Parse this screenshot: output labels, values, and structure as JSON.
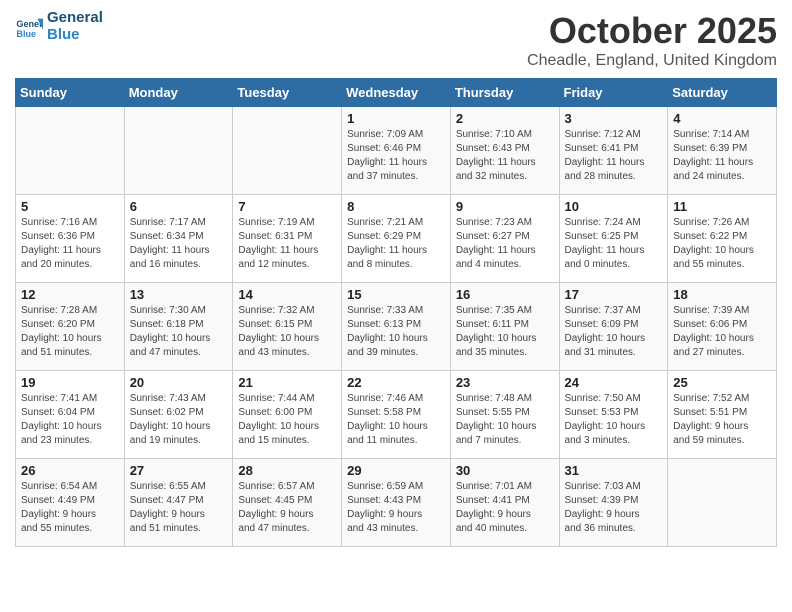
{
  "logo": {
    "line1": "General",
    "line2": "Blue"
  },
  "title": "October 2025",
  "location": "Cheadle, England, United Kingdom",
  "days_of_week": [
    "Sunday",
    "Monday",
    "Tuesday",
    "Wednesday",
    "Thursday",
    "Friday",
    "Saturday"
  ],
  "weeks": [
    [
      {
        "num": "",
        "info": ""
      },
      {
        "num": "",
        "info": ""
      },
      {
        "num": "",
        "info": ""
      },
      {
        "num": "1",
        "info": "Sunrise: 7:09 AM\nSunset: 6:46 PM\nDaylight: 11 hours\nand 37 minutes."
      },
      {
        "num": "2",
        "info": "Sunrise: 7:10 AM\nSunset: 6:43 PM\nDaylight: 11 hours\nand 32 minutes."
      },
      {
        "num": "3",
        "info": "Sunrise: 7:12 AM\nSunset: 6:41 PM\nDaylight: 11 hours\nand 28 minutes."
      },
      {
        "num": "4",
        "info": "Sunrise: 7:14 AM\nSunset: 6:39 PM\nDaylight: 11 hours\nand 24 minutes."
      }
    ],
    [
      {
        "num": "5",
        "info": "Sunrise: 7:16 AM\nSunset: 6:36 PM\nDaylight: 11 hours\nand 20 minutes."
      },
      {
        "num": "6",
        "info": "Sunrise: 7:17 AM\nSunset: 6:34 PM\nDaylight: 11 hours\nand 16 minutes."
      },
      {
        "num": "7",
        "info": "Sunrise: 7:19 AM\nSunset: 6:31 PM\nDaylight: 11 hours\nand 12 minutes."
      },
      {
        "num": "8",
        "info": "Sunrise: 7:21 AM\nSunset: 6:29 PM\nDaylight: 11 hours\nand 8 minutes."
      },
      {
        "num": "9",
        "info": "Sunrise: 7:23 AM\nSunset: 6:27 PM\nDaylight: 11 hours\nand 4 minutes."
      },
      {
        "num": "10",
        "info": "Sunrise: 7:24 AM\nSunset: 6:25 PM\nDaylight: 11 hours\nand 0 minutes."
      },
      {
        "num": "11",
        "info": "Sunrise: 7:26 AM\nSunset: 6:22 PM\nDaylight: 10 hours\nand 55 minutes."
      }
    ],
    [
      {
        "num": "12",
        "info": "Sunrise: 7:28 AM\nSunset: 6:20 PM\nDaylight: 10 hours\nand 51 minutes."
      },
      {
        "num": "13",
        "info": "Sunrise: 7:30 AM\nSunset: 6:18 PM\nDaylight: 10 hours\nand 47 minutes."
      },
      {
        "num": "14",
        "info": "Sunrise: 7:32 AM\nSunset: 6:15 PM\nDaylight: 10 hours\nand 43 minutes."
      },
      {
        "num": "15",
        "info": "Sunrise: 7:33 AM\nSunset: 6:13 PM\nDaylight: 10 hours\nand 39 minutes."
      },
      {
        "num": "16",
        "info": "Sunrise: 7:35 AM\nSunset: 6:11 PM\nDaylight: 10 hours\nand 35 minutes."
      },
      {
        "num": "17",
        "info": "Sunrise: 7:37 AM\nSunset: 6:09 PM\nDaylight: 10 hours\nand 31 minutes."
      },
      {
        "num": "18",
        "info": "Sunrise: 7:39 AM\nSunset: 6:06 PM\nDaylight: 10 hours\nand 27 minutes."
      }
    ],
    [
      {
        "num": "19",
        "info": "Sunrise: 7:41 AM\nSunset: 6:04 PM\nDaylight: 10 hours\nand 23 minutes."
      },
      {
        "num": "20",
        "info": "Sunrise: 7:43 AM\nSunset: 6:02 PM\nDaylight: 10 hours\nand 19 minutes."
      },
      {
        "num": "21",
        "info": "Sunrise: 7:44 AM\nSunset: 6:00 PM\nDaylight: 10 hours\nand 15 minutes."
      },
      {
        "num": "22",
        "info": "Sunrise: 7:46 AM\nSunset: 5:58 PM\nDaylight: 10 hours\nand 11 minutes."
      },
      {
        "num": "23",
        "info": "Sunrise: 7:48 AM\nSunset: 5:55 PM\nDaylight: 10 hours\nand 7 minutes."
      },
      {
        "num": "24",
        "info": "Sunrise: 7:50 AM\nSunset: 5:53 PM\nDaylight: 10 hours\nand 3 minutes."
      },
      {
        "num": "25",
        "info": "Sunrise: 7:52 AM\nSunset: 5:51 PM\nDaylight: 9 hours\nand 59 minutes."
      }
    ],
    [
      {
        "num": "26",
        "info": "Sunrise: 6:54 AM\nSunset: 4:49 PM\nDaylight: 9 hours\nand 55 minutes."
      },
      {
        "num": "27",
        "info": "Sunrise: 6:55 AM\nSunset: 4:47 PM\nDaylight: 9 hours\nand 51 minutes."
      },
      {
        "num": "28",
        "info": "Sunrise: 6:57 AM\nSunset: 4:45 PM\nDaylight: 9 hours\nand 47 minutes."
      },
      {
        "num": "29",
        "info": "Sunrise: 6:59 AM\nSunset: 4:43 PM\nDaylight: 9 hours\nand 43 minutes."
      },
      {
        "num": "30",
        "info": "Sunrise: 7:01 AM\nSunset: 4:41 PM\nDaylight: 9 hours\nand 40 minutes."
      },
      {
        "num": "31",
        "info": "Sunrise: 7:03 AM\nSunset: 4:39 PM\nDaylight: 9 hours\nand 36 minutes."
      },
      {
        "num": "",
        "info": ""
      }
    ]
  ]
}
